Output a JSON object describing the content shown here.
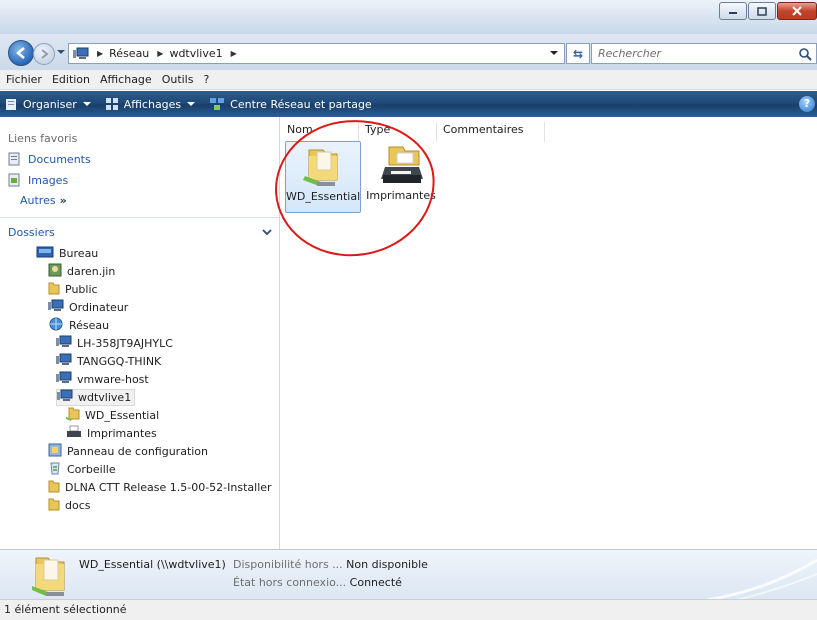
{
  "address": {
    "crumbs": [
      "Réseau",
      "wdtvlive1"
    ],
    "search_placeholder": "Rechercher"
  },
  "menu": [
    "Fichier",
    "Edition",
    "Affichage",
    "Outils",
    "?"
  ],
  "commands": {
    "organiser": "Organiser",
    "affichages": "Affichages",
    "centre": "Centre Réseau et partage"
  },
  "favorites": {
    "header": "Liens favoris",
    "links": [
      "Documents",
      "Images"
    ],
    "more": "Autres",
    "more_arrow": "»"
  },
  "folders": {
    "header": "Dossiers",
    "items": [
      {
        "label": "Bureau",
        "icon": "desktop-icon",
        "level": 0
      },
      {
        "label": "daren.jin",
        "icon": "user-folder-icon",
        "level": 1
      },
      {
        "label": "Public",
        "icon": "folder-icon",
        "level": 1
      },
      {
        "label": "Ordinateur",
        "icon": "computer-icon",
        "level": 1
      },
      {
        "label": "Réseau",
        "icon": "network-icon",
        "level": 1
      },
      {
        "label": "LH-358JT9AJHYLC",
        "icon": "computer-icon",
        "level": 2
      },
      {
        "label": "TANGGQ-THINK",
        "icon": "computer-icon",
        "level": 2
      },
      {
        "label": "vmware-host",
        "icon": "computer-icon",
        "level": 2
      },
      {
        "label": "wdtvlive1",
        "icon": "computer-icon",
        "level": 2,
        "selected": true
      },
      {
        "label": "WD_Essential",
        "icon": "shared-folder-icon",
        "level": 3
      },
      {
        "label": "Imprimantes",
        "icon": "printer-icon",
        "level": 3
      },
      {
        "label": "Panneau de configuration",
        "icon": "control-panel-icon",
        "level": 1
      },
      {
        "label": "Corbeille",
        "icon": "recycle-bin-icon",
        "level": 1
      },
      {
        "label": "DLNA CTT Release 1.5-00-52-Installer",
        "icon": "folder-icon",
        "level": 1
      },
      {
        "label": "docs",
        "icon": "folder-icon",
        "level": 1
      }
    ]
  },
  "columns": [
    "Nom",
    "Type",
    "Commentaires"
  ],
  "files": [
    {
      "label": "WD_Essential",
      "icon": "shared-folder-icon",
      "selected": true
    },
    {
      "label": "Imprimantes",
      "icon": "printer-icon",
      "selected": false
    }
  ],
  "details": {
    "name": "WD_Essential (\\\\wdtvlive1)",
    "rows": [
      {
        "key": "Disponibilité hors ...",
        "value": "Non disponible"
      },
      {
        "key": "État hors connexio...",
        "value": "Connecté"
      }
    ]
  },
  "status": "1 élément sélectionné",
  "colors": {
    "annotation": "#e01717",
    "link": "#1e5aa8",
    "command_bar": "#1f4a79"
  }
}
